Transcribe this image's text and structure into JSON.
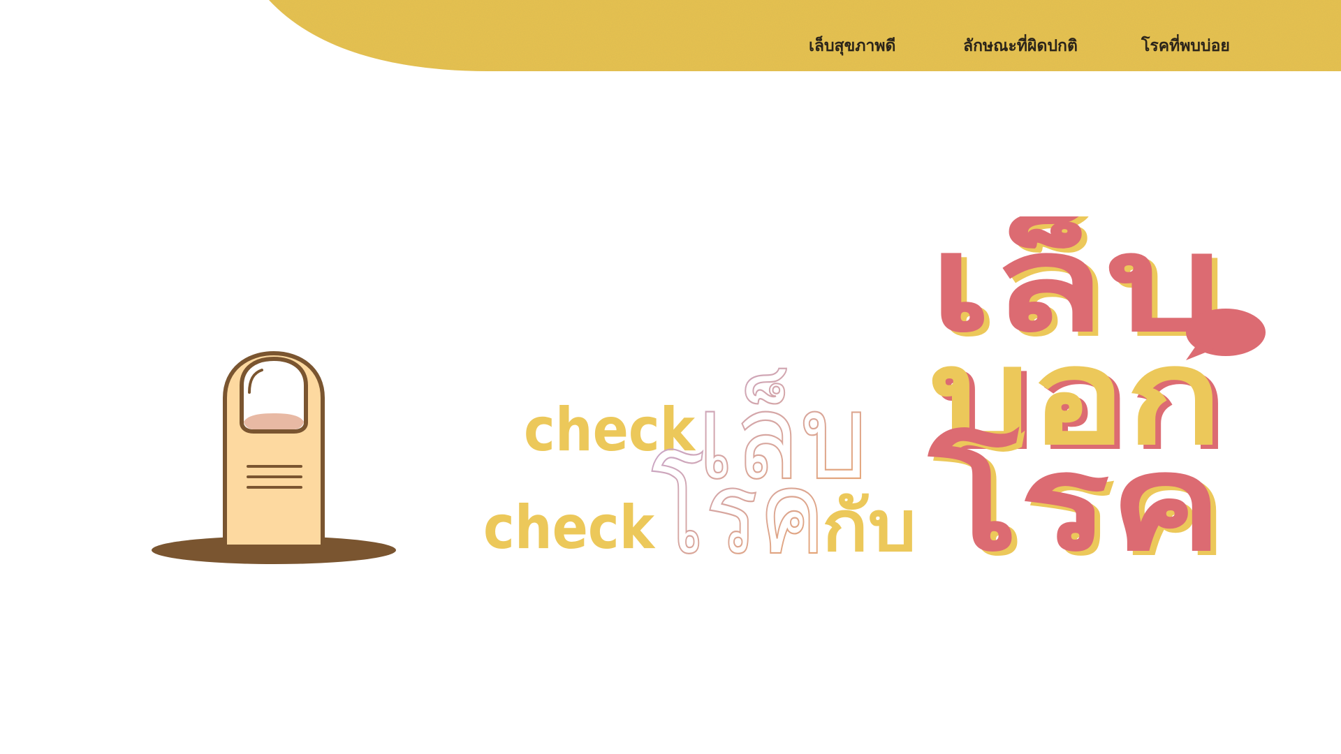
{
  "nav": {
    "items": [
      {
        "label": "เล็บสุขภาพดี"
      },
      {
        "label": "ลักษณะที่ผิดปกติ"
      },
      {
        "label": "โรคที่พบบ่อย"
      }
    ]
  },
  "hero": {
    "line1_prefix": "check",
    "line1_thai": "เล็บ",
    "line2_prefix": "check",
    "line2_thai": "โรค",
    "line2_suffix": "กับ",
    "logo_row1": "เล็บ",
    "logo_row2": "บอก",
    "logo_row3": "โรค"
  },
  "colors": {
    "banner": "#e8c250",
    "yellow": "#ecc85a",
    "pink": "#dc6b72",
    "skin": "#fdd9a0",
    "brown": "#7a5530",
    "nail": "#ffffff",
    "nail_bed": "#e8b9a4",
    "outline_grad_start": "#c9a6c9",
    "outline_grad_end": "#e8a56c"
  },
  "icons": {
    "finger": "finger-nail-icon",
    "speech": "speech-bubble-icon"
  }
}
